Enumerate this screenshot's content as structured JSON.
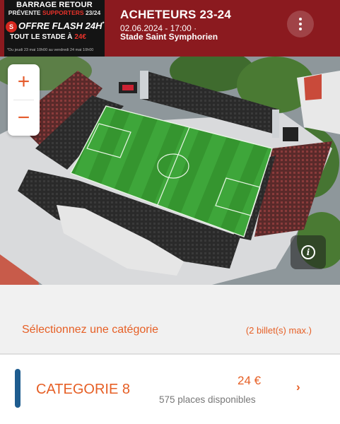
{
  "promo": {
    "line1": "BARRAGE RETOUR",
    "line2_prefix": "PRÉVENTE",
    "line2_highlight": "SUPPORTERS",
    "line2_suffix": "23/24",
    "badge": "S",
    "flash": "OFFRE FLASH 24H",
    "flash_sup": "*",
    "stadium_offer": "TOUT LE STADE À",
    "stadium_price": "24€",
    "footnote": "*Du jeudi 23 mai 10h00 au vendredi 24 mai 10h00"
  },
  "event": {
    "title": "ACHETEURS 23-24",
    "date": "02.06.2024 - 17:00 ·",
    "venue": "Stade Saint Symphorien"
  },
  "icons": {
    "more": "more-vertical-icon",
    "info": "info-icon",
    "chevron": "chevron-right-icon"
  },
  "zoom": {
    "in": "+",
    "out": "−"
  },
  "info_label": "i",
  "selection": {
    "title": "Sélectionnez une catégorie",
    "max": "(2 billet(s) max.)"
  },
  "category": {
    "name": "CATEGORIE 8",
    "price": "24 €",
    "availability": "575 places disponibles",
    "chevron": "›"
  },
  "colors": {
    "header_bg": "#8b1a1f",
    "accent_orange": "#e65f25",
    "category_marker": "#1e5c8f",
    "pitch_green": "#3aa035"
  }
}
